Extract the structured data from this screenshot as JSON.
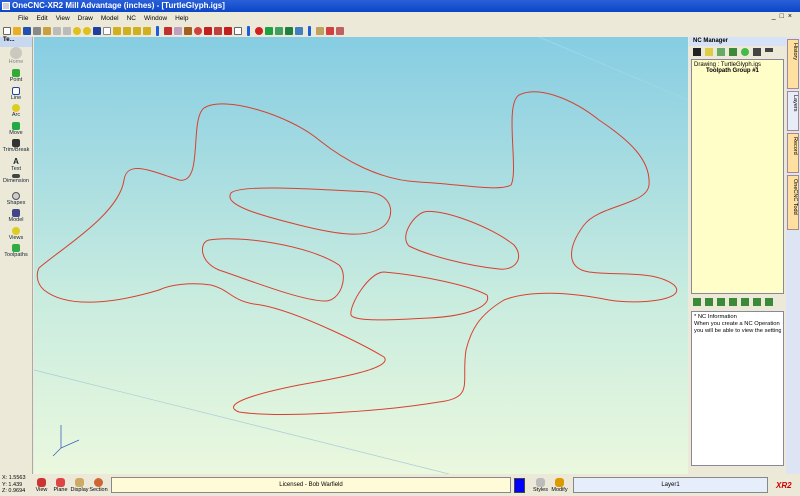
{
  "title": "OneCNC-XR2 Mill Advantage (inches) - [TurtleGlyph.igs]",
  "menu": [
    "File",
    "Edit",
    "View",
    "Draw",
    "Model",
    "NC",
    "Window",
    "Help"
  ],
  "left_panel": {
    "header": "Te...",
    "tools": [
      "Home",
      "Point",
      "Line",
      "Arc",
      "Move",
      "Trim/Break",
      "Text",
      "Dimension",
      "Shapes",
      "Model",
      "Views",
      "Toolpaths"
    ]
  },
  "nc_manager": {
    "title": "NC Manager",
    "drawing": "Drawing : TurtleGlyph.igs",
    "group": "Toolpath Group #1",
    "info": [
      "* NC Information",
      "When you create a NC Operation",
      "you will be able to view the settings h"
    ]
  },
  "side_tabs": [
    "History",
    "Layers",
    "Record",
    "OneCNC Todd"
  ],
  "status": {
    "x": "X: 1.5563",
    "y": "Y: 1.439",
    "z": "Z: 0.9694",
    "buttons": [
      "View",
      "Plane",
      "Display",
      "Section"
    ],
    "license": "Licensed - Bob Warfield",
    "styles": "Styles",
    "modify": "Modify",
    "layer": "Layer1",
    "logo": "XR2"
  },
  "colors": {
    "curve": "#d84030",
    "active_color": "#0000ff"
  }
}
